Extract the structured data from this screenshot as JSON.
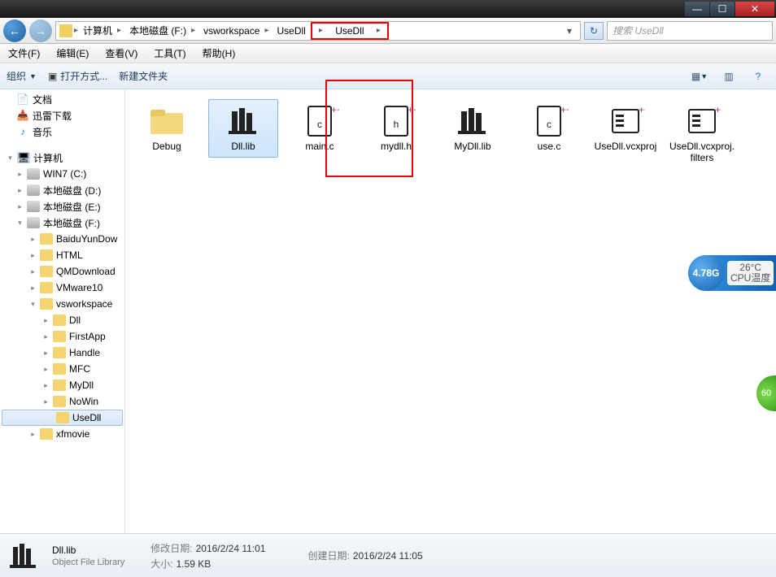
{
  "titlebar": {
    "min": "—",
    "max": "☐",
    "close": "✕"
  },
  "nav": {
    "back": "←",
    "fwd": "→",
    "refresh": "↻"
  },
  "breadcrumb": {
    "segments": [
      "计算机",
      "本地磁盘 (F:)",
      "vsworkspace",
      "UseDll",
      "UseDll"
    ],
    "highlighted_index": 4
  },
  "search": {
    "placeholder": "搜索 UseDll"
  },
  "menu": {
    "items": [
      "文件(F)",
      "编辑(E)",
      "查看(V)",
      "工具(T)",
      "帮助(H)"
    ]
  },
  "toolbar": {
    "organize": "组织",
    "open_with": "打开方式...",
    "new_folder": "新建文件夹"
  },
  "sidebar": {
    "top": [
      {
        "label": "文档",
        "icon": "doc"
      },
      {
        "label": "迅雷下载",
        "icon": "dl"
      },
      {
        "label": "音乐",
        "icon": "music"
      }
    ],
    "computer": "计算机",
    "drives": [
      {
        "label": "WIN7 (C:)",
        "icon": "win"
      },
      {
        "label": "本地磁盘 (D:)",
        "icon": "drive"
      },
      {
        "label": "本地磁盘 (E:)",
        "icon": "drive"
      },
      {
        "label": "本地磁盘 (F:)",
        "icon": "drive",
        "expanded": true
      }
    ],
    "f_children": [
      "BaiduYunDow",
      "HTML",
      "QMDownload",
      "VMware10"
    ],
    "workspace": "vsworkspace",
    "ws_children": [
      "Dll",
      "FirstApp",
      "Handle",
      "MFC",
      "MyDll",
      "NoWin",
      "UseDll"
    ],
    "selected": "UseDll",
    "xfmovie": "xfmovie"
  },
  "files": [
    {
      "name": "Debug",
      "type": "folder"
    },
    {
      "name": "Dll.lib",
      "type": "lib",
      "selected": true
    },
    {
      "name": "main.c",
      "type": "c"
    },
    {
      "name": "mydll.h",
      "type": "h"
    },
    {
      "name": "MyDll.lib",
      "type": "lib"
    },
    {
      "name": "use.c",
      "type": "c"
    },
    {
      "name": "UseDll.vcxproj",
      "type": "vcx"
    },
    {
      "name": "UseDll.vcxproj.filters",
      "type": "vcxf"
    }
  ],
  "widget": {
    "disk": "4.78G",
    "temp": "26°C",
    "temp_label": "CPU温度",
    "green": "60"
  },
  "status": {
    "name": "Dll.lib",
    "type": "Object File Library",
    "modified_label": "修改日期:",
    "modified": "2016/2/24 11:01",
    "created_label": "创建日期:",
    "created": "2016/2/24 11:05",
    "size_label": "大小:",
    "size": "1.59 KB"
  }
}
